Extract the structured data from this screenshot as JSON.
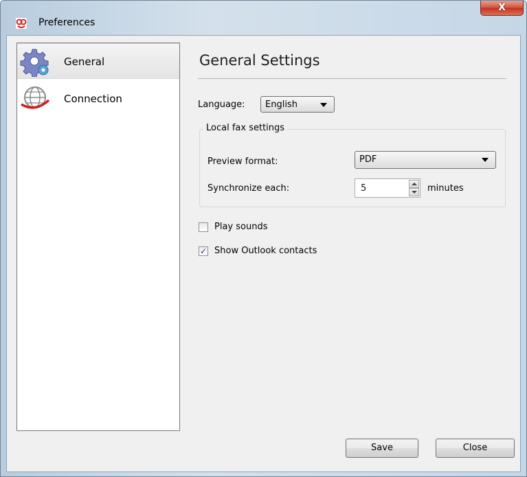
{
  "window": {
    "title": "Preferences",
    "close_label": "X",
    "colors": {
      "accent_close": "#c2331e",
      "frame": "#c5d6e6"
    }
  },
  "sidebar": {
    "items": [
      {
        "label": "General",
        "icon": "gear-icon",
        "selected": true
      },
      {
        "label": "Connection",
        "icon": "globe-icon",
        "selected": false
      }
    ]
  },
  "main": {
    "title": "General Settings",
    "language": {
      "label": "Language:",
      "value": "English"
    },
    "local_fax": {
      "group_title": "Local fax settings",
      "preview_format": {
        "label": "Preview format:",
        "value": "PDF"
      },
      "synchronize": {
        "label": "Synchronize  each:",
        "value": "5",
        "unit": "minutes"
      }
    },
    "play_sounds": {
      "label": "Play sounds",
      "checked": false
    },
    "show_outlook_contacts": {
      "label": "Show Outlook contacts",
      "checked": true,
      "mark": "✓"
    }
  },
  "footer": {
    "save_label": "Save",
    "close_label": "Close"
  }
}
